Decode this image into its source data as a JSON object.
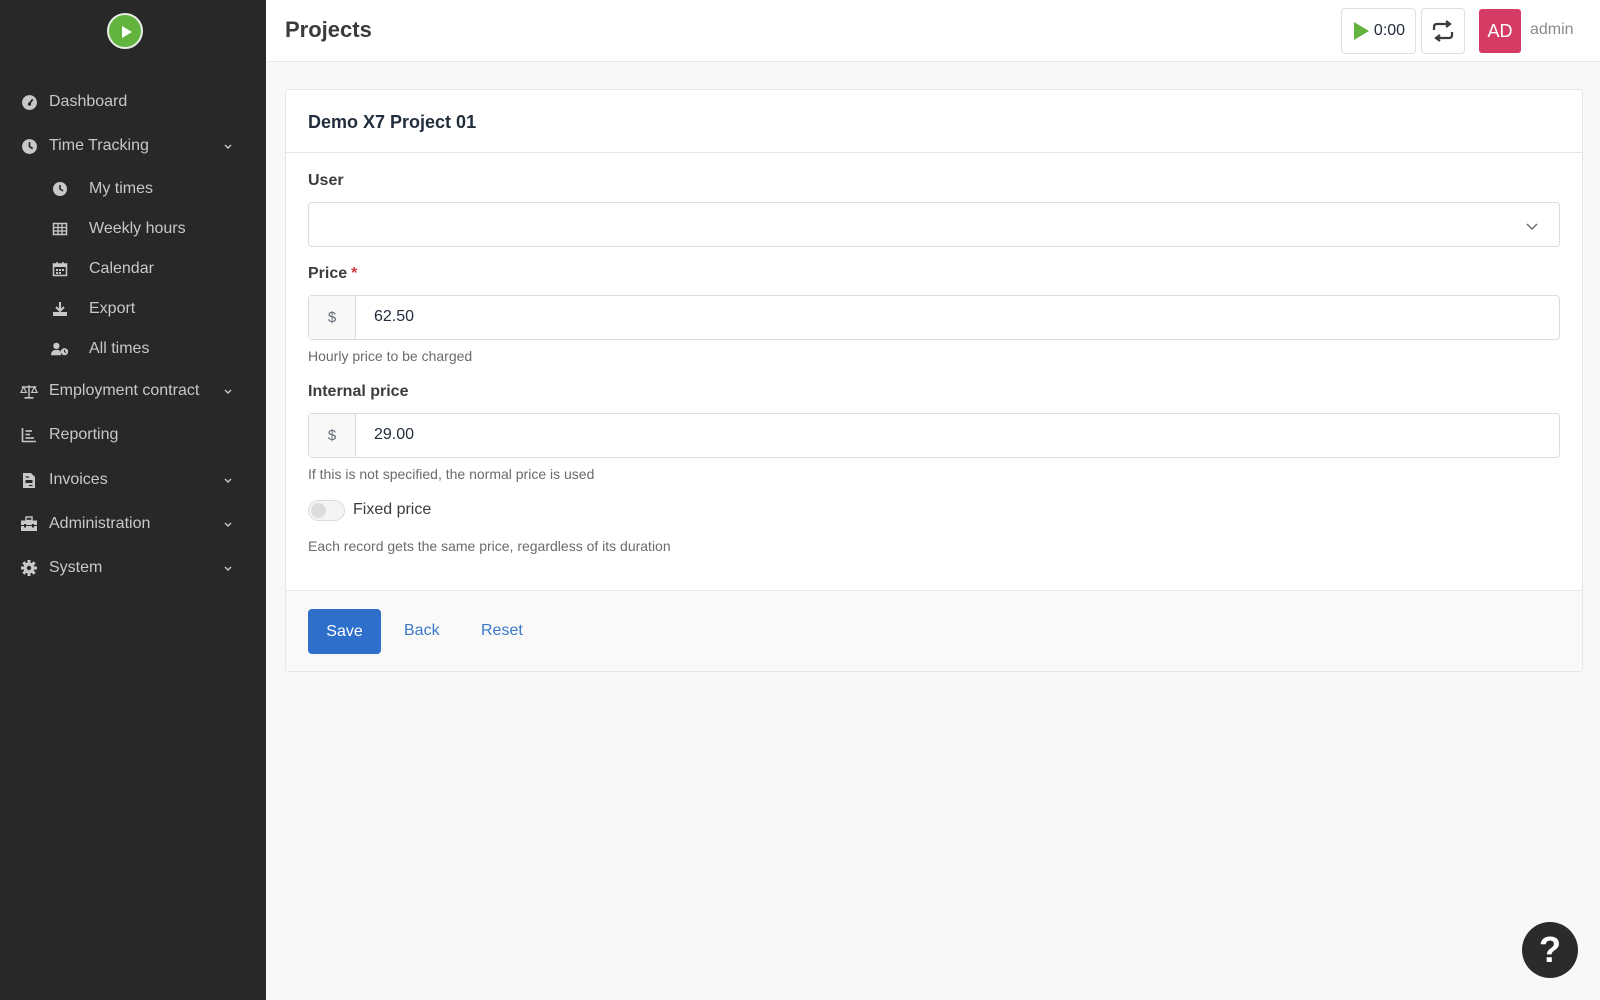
{
  "sidebar": {
    "items": [
      {
        "label": "Dashboard",
        "icon": "dashboard-icon"
      },
      {
        "label": "Time Tracking",
        "icon": "clock-icon",
        "expanded": true
      },
      {
        "label": "My times",
        "icon": "clock-icon"
      },
      {
        "label": "Weekly hours",
        "icon": "table-icon"
      },
      {
        "label": "Calendar",
        "icon": "calendar-icon"
      },
      {
        "label": "Export",
        "icon": "download-icon"
      },
      {
        "label": "All times",
        "icon": "user-clock-icon"
      },
      {
        "label": "Employment contract",
        "icon": "balance-scale-icon"
      },
      {
        "label": "Reporting",
        "icon": "chart-icon"
      },
      {
        "label": "Invoices",
        "icon": "file-invoice-icon"
      },
      {
        "label": "Administration",
        "icon": "toolbox-icon"
      },
      {
        "label": "System",
        "icon": "gear-icon"
      }
    ]
  },
  "header": {
    "title": "Projects",
    "timer": "0:00",
    "avatar_initials": "AD",
    "username": "admin"
  },
  "form": {
    "title": "Demo X7 Project 01",
    "user_label": "User",
    "user_value": "",
    "price_label": "Price",
    "price_required": "*",
    "currency": "$",
    "price_value": "62.50",
    "price_help": "Hourly price to be charged",
    "internal_price_label": "Internal price",
    "internal_price_value": "29.00",
    "internal_price_help": "If this is not specified, the normal price is used",
    "fixed_price_label": "Fixed price",
    "fixed_price_on": false,
    "fixed_price_help": "Each record gets the same price, regardless of its duration",
    "save_label": "Save",
    "back_label": "Back",
    "reset_label": "Reset"
  },
  "help_button": "?",
  "colors": {
    "sidebar_bg": "#282828",
    "primary": "#2e6fcc",
    "avatar_bg": "#d63c63",
    "timer_play": "#63b33f",
    "required": "#d63939"
  }
}
